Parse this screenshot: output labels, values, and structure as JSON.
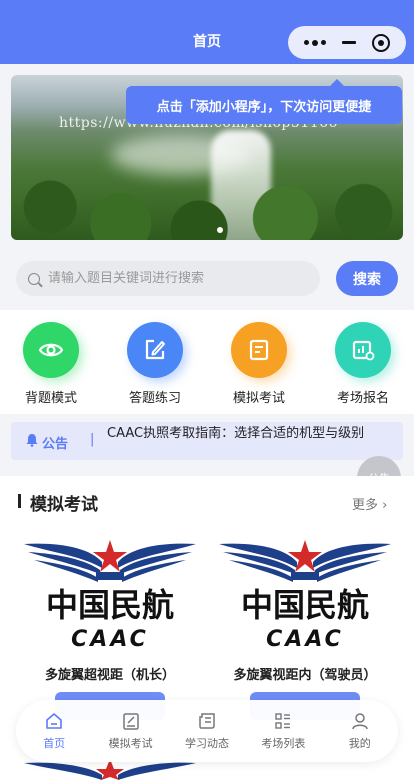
{
  "header": {
    "title": "首页"
  },
  "tip": {
    "text": "点击「添加小程序」，下次访问更便捷"
  },
  "banner": {
    "watermark": "https://www.huzhan.com/ishop51166",
    "dots": 1
  },
  "search": {
    "placeholder": "请输入题目关键词进行搜索",
    "button": "搜索"
  },
  "actions": [
    {
      "label": "背题模式",
      "icon": "eye-icon",
      "color": "#2fd668"
    },
    {
      "label": "答题练习",
      "icon": "edit-icon",
      "color": "#4a86f5"
    },
    {
      "label": "模拟考试",
      "icon": "document-icon",
      "color": "#f6a123"
    },
    {
      "label": "考场报名",
      "icon": "chart-icon",
      "color": "#2fd3b5"
    }
  ],
  "notice": {
    "tag": "公告",
    "separator": "|",
    "text": "CAAC执照考取指南：选择合适的机型与级别"
  },
  "floats": {
    "announcement": "公告"
  },
  "exam_section": {
    "title": "模拟考试",
    "more": "更多",
    "cards": [
      {
        "logo_text": "中国民航",
        "logo_sub": "CAAC",
        "title": "多旋翼超视距（机长）"
      },
      {
        "logo_text": "中国民航",
        "logo_sub": "CAAC",
        "title": "多旋翼视距内（驾驶员）"
      }
    ]
  },
  "tabbar": [
    {
      "label": "首页",
      "icon": "home-icon",
      "active": true
    },
    {
      "label": "模拟考试",
      "icon": "exam-icon",
      "active": false
    },
    {
      "label": "学习动态",
      "icon": "news-icon",
      "active": false
    },
    {
      "label": "考场列表",
      "icon": "list-icon",
      "active": false
    },
    {
      "label": "我的",
      "icon": "user-icon",
      "active": false
    }
  ],
  "colors": {
    "primary": "#5a7cf7",
    "notice_bg": "#e5e7fb"
  }
}
